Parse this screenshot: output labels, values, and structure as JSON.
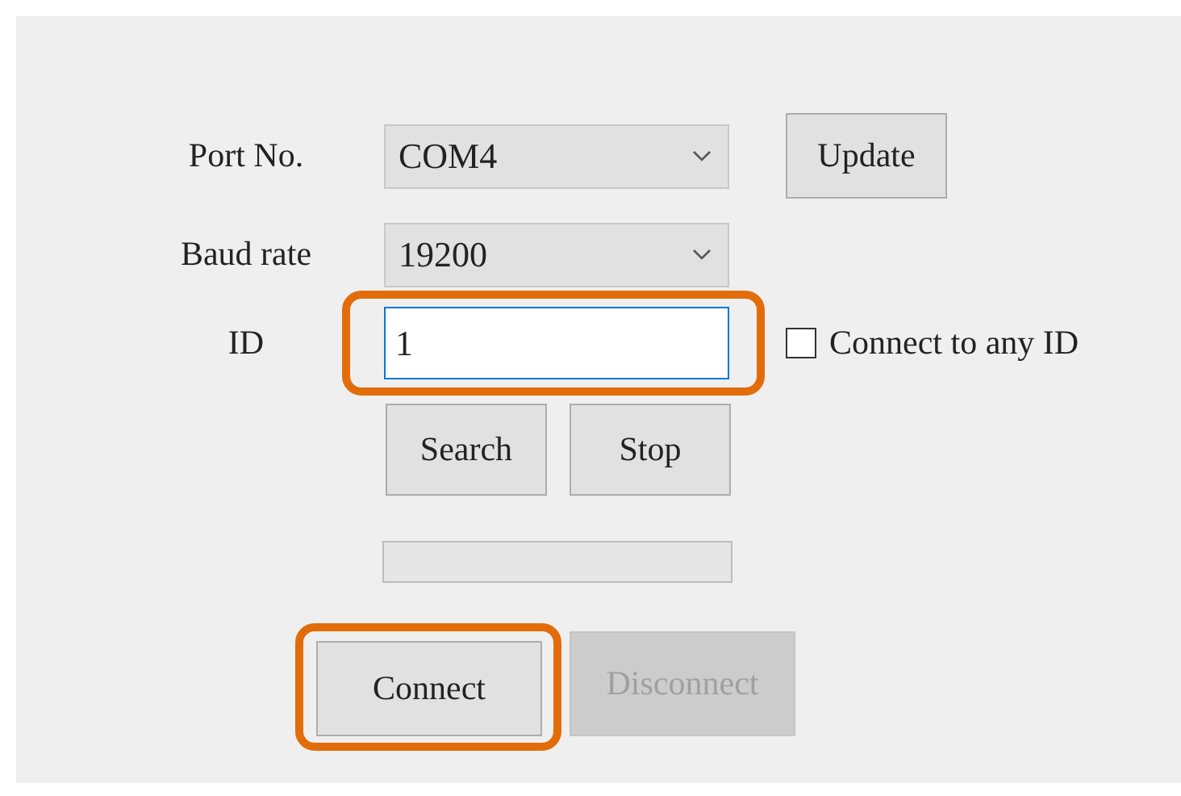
{
  "port": {
    "label": "Port No.",
    "value": "COM4",
    "button": "Update"
  },
  "baud": {
    "label": "Baud rate",
    "value": "19200"
  },
  "id": {
    "label": "ID",
    "value": "1",
    "focused": true,
    "highlighted": true,
    "checkbox": {
      "label": "Connect to any ID",
      "checked": false
    }
  },
  "search_buttons": [
    {
      "label": "Search",
      "disabled": false
    },
    {
      "label": "Stop",
      "disabled": false
    }
  ],
  "progress": {
    "level": 0
  },
  "connection_buttons": [
    {
      "label": "Connect",
      "disabled": false,
      "highlighted": true
    },
    {
      "label": "Disconnect",
      "disabled": true,
      "highlighted": false
    }
  ]
}
